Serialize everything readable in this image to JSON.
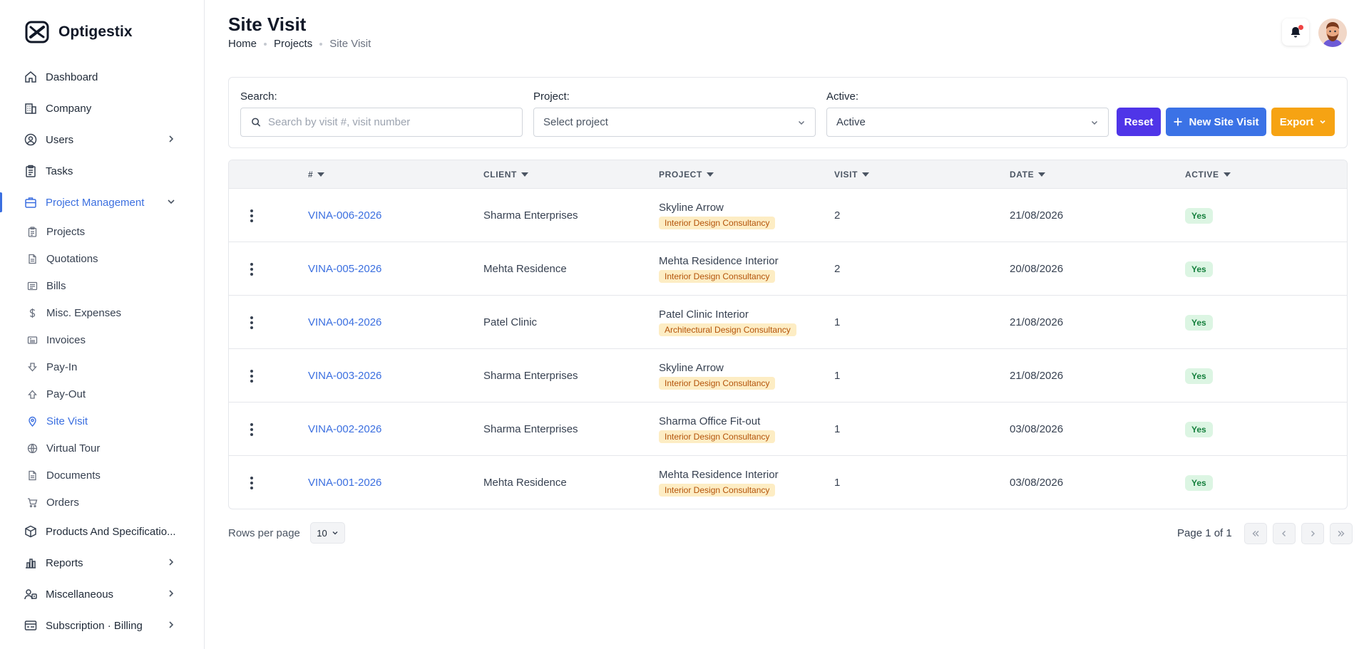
{
  "app": {
    "name": "Optigestix"
  },
  "sidebar": {
    "items": [
      {
        "label": "Dashboard",
        "icon": "home-icon"
      },
      {
        "label": "Company",
        "icon": "building-icon"
      },
      {
        "label": "Users",
        "icon": "user-circle-icon",
        "expandable": true
      },
      {
        "label": "Tasks",
        "icon": "clipboard-icon"
      },
      {
        "label": "Project Management",
        "icon": "briefcase-icon",
        "expanded": true,
        "active": true
      },
      {
        "label": "Products And Specificatio...",
        "icon": "cube-icon"
      },
      {
        "label": "Reports",
        "icon": "bar-chart-icon",
        "expandable": true
      },
      {
        "label": "Miscellaneous",
        "icon": "people-icon",
        "expandable": true
      },
      {
        "label": "Subscription · Billing",
        "icon": "billing-icon",
        "expandable": true
      }
    ],
    "project_management_children": [
      {
        "label": "Projects",
        "icon": "clipboard-icon"
      },
      {
        "label": "Quotations",
        "icon": "document-icon"
      },
      {
        "label": "Bills",
        "icon": "bill-icon"
      },
      {
        "label": "Misc. Expenses",
        "icon": "dollar-icon"
      },
      {
        "label": "Invoices",
        "icon": "invoice-icon"
      },
      {
        "label": "Pay-In",
        "icon": "pay-in-icon"
      },
      {
        "label": "Pay-Out",
        "icon": "pay-out-icon"
      },
      {
        "label": "Site Visit",
        "icon": "map-pin-icon",
        "current": true
      },
      {
        "label": "Virtual Tour",
        "icon": "globe-icon"
      },
      {
        "label": "Documents",
        "icon": "document-icon"
      },
      {
        "label": "Orders",
        "icon": "cart-icon"
      }
    ]
  },
  "header": {
    "title": "Site Visit",
    "breadcrumb": [
      "Home",
      "Projects",
      "Site Visit"
    ]
  },
  "filters": {
    "search_label": "Search:",
    "search_placeholder": "Search by visit #, visit number",
    "project_label": "Project:",
    "project_placeholder": "Select project",
    "active_label": "Active:",
    "active_value": "Active",
    "reset_label": "Reset",
    "new_label": "New Site Visit",
    "export_label": "Export"
  },
  "table": {
    "columns": [
      "#",
      "CLIENT",
      "PROJECT",
      "VISIT",
      "DATE",
      "ACTIVE"
    ],
    "rows": [
      {
        "id": "VINA-006-2026",
        "client": "Sharma Enterprises",
        "project": "Skyline Arrow",
        "tag": "Interior Design Consultancy",
        "visit": "2",
        "date": "21/08/2026",
        "active": "Yes"
      },
      {
        "id": "VINA-005-2026",
        "client": "Mehta Residence",
        "project": "Mehta Residence Interior",
        "tag": "Interior Design Consultancy",
        "visit": "2",
        "date": "20/08/2026",
        "active": "Yes"
      },
      {
        "id": "VINA-004-2026",
        "client": "Patel Clinic",
        "project": "Patel Clinic Interior",
        "tag": "Architectural Design Consultancy",
        "visit": "1",
        "date": "21/08/2026",
        "active": "Yes"
      },
      {
        "id": "VINA-003-2026",
        "client": "Sharma Enterprises",
        "project": "Skyline Arrow",
        "tag": "Interior Design Consultancy",
        "visit": "1",
        "date": "21/08/2026",
        "active": "Yes"
      },
      {
        "id": "VINA-002-2026",
        "client": "Sharma Enterprises",
        "project": "Sharma Office Fit-out",
        "tag": "Interior Design Consultancy",
        "visit": "1",
        "date": "03/08/2026",
        "active": "Yes"
      },
      {
        "id": "VINA-001-2026",
        "client": "Mehta Residence",
        "project": "Mehta Residence Interior",
        "tag": "Interior Design Consultancy",
        "visit": "1",
        "date": "03/08/2026",
        "active": "Yes"
      }
    ]
  },
  "pagination": {
    "rows_per_page_label": "Rows per page",
    "rows_per_page_value": "10",
    "page_info": "Page 1 of 1"
  },
  "colors": {
    "primary": "#3b6fe0",
    "reset": "#4f35e8",
    "new": "#3b72e6",
    "export": "#f6a313",
    "badge_yes_bg": "#dcf5e3",
    "tag_bg": "#fdedc4"
  }
}
